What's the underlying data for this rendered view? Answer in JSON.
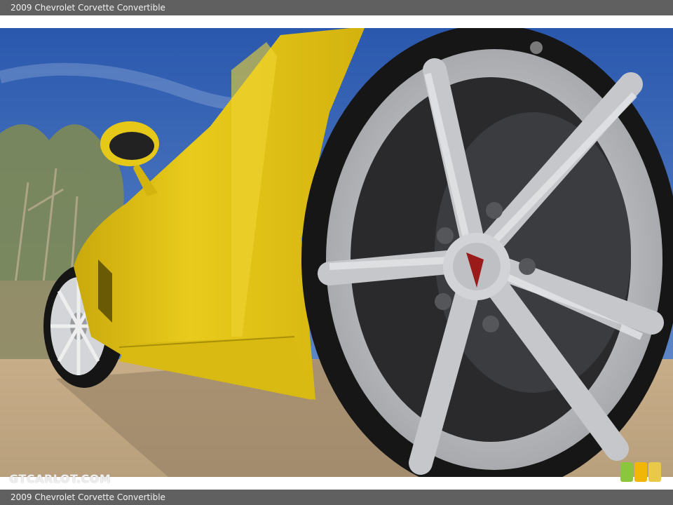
{
  "header": {
    "title": "2009 Chevrolet Corvette Convertible"
  },
  "footer": {
    "caption": "2009 Chevrolet Corvette Convertible"
  },
  "watermark": {
    "text": "GTCARLOT.COM"
  },
  "photo": {
    "subject": "yellow-car-front-wheel",
    "colors": {
      "sky": "#2f5fb0",
      "body": "#e6c815",
      "road": "#c9b08c",
      "rim": "#c8c9cc",
      "tire": "#1a1a1a"
    }
  },
  "logo": {
    "colors": [
      "#8cc63f",
      "#f2b705",
      "#e8c948"
    ]
  }
}
